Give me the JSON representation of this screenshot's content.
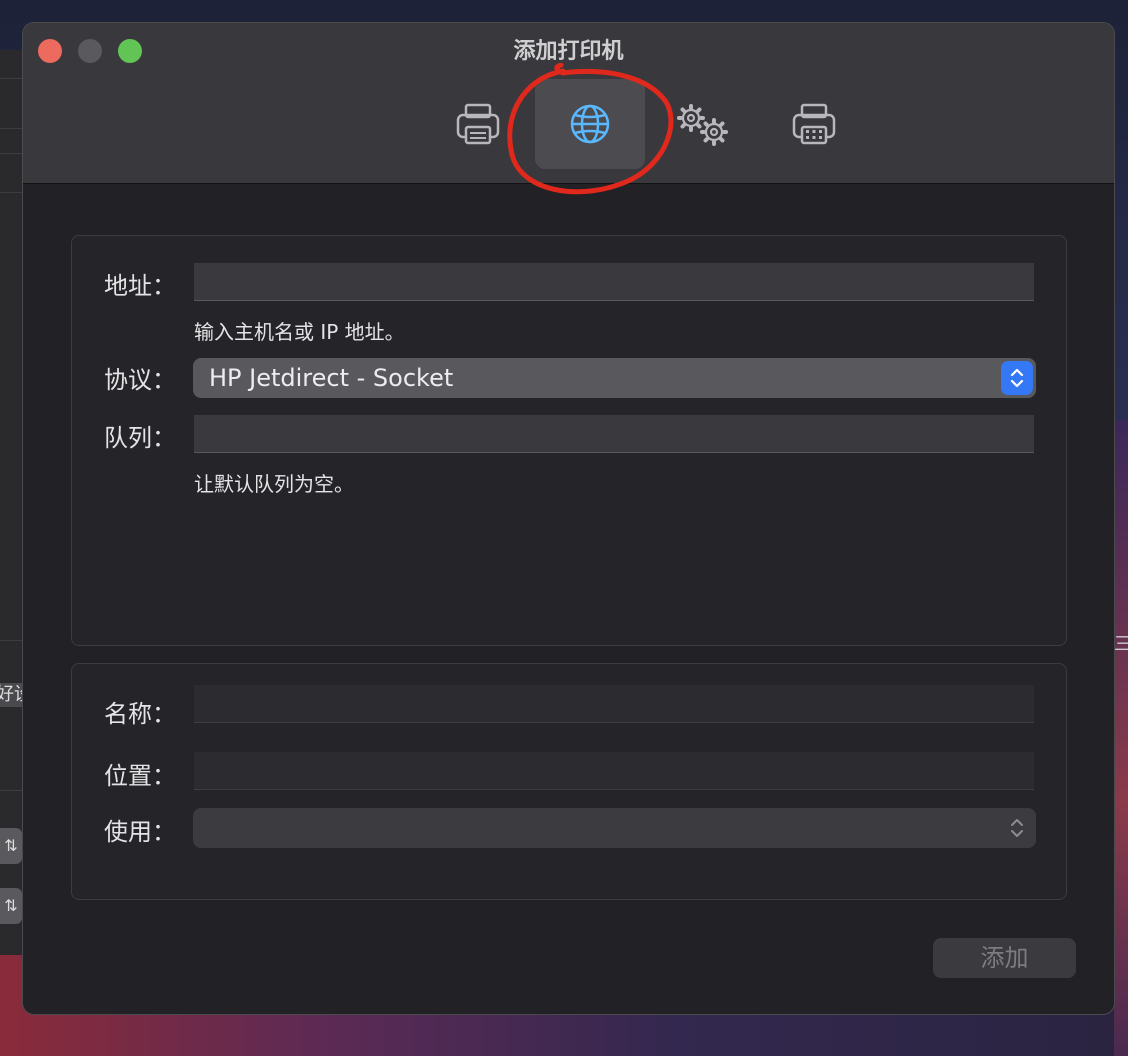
{
  "window": {
    "title": "添加打印机"
  },
  "toolbar": {
    "items": [
      {
        "icon": "printer-icon",
        "active": false
      },
      {
        "icon": "globe-icon",
        "active": true
      },
      {
        "icon": "gears-icon",
        "active": false
      },
      {
        "icon": "printer-grid-icon",
        "active": false
      }
    ]
  },
  "address": {
    "label": "地址：",
    "value": "",
    "hint": "输入主机名或 IP 地址。"
  },
  "protocol": {
    "label": "协议：",
    "selected": "HP Jetdirect - Socket"
  },
  "queue": {
    "label": "队列：",
    "value": "",
    "hint": "让默认队列为空。"
  },
  "name": {
    "label": "名称：",
    "value": ""
  },
  "location": {
    "label": "位置：",
    "value": ""
  },
  "use": {
    "label": "使用：",
    "selected": ""
  },
  "add_button": {
    "label": "添加"
  },
  "background": {
    "left_fragment": "好设",
    "right_fragment": "三"
  },
  "colors": {
    "accent": "#3478f6",
    "annotation": "#e0291c",
    "globe": "#5ab8ff"
  }
}
